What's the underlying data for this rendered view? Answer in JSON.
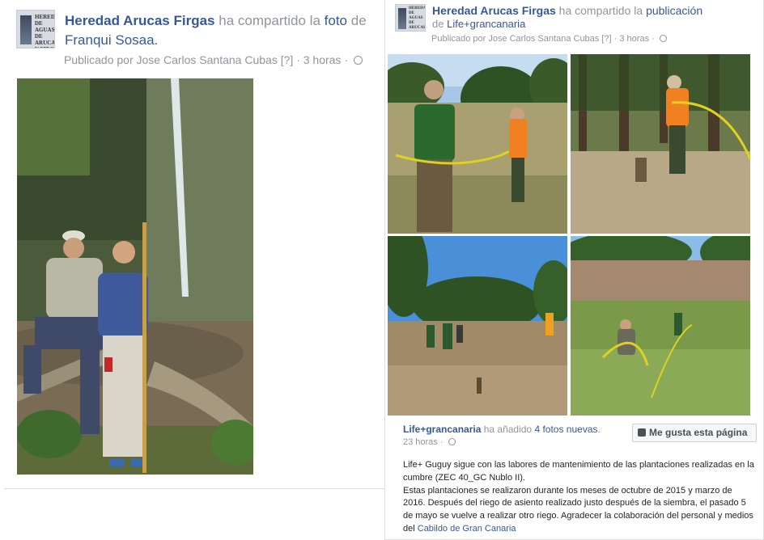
{
  "left_post": {
    "page_name": "Heredad Arucas Firgas",
    "action_text": "ha compartido la",
    "action_link": "foto",
    "action_suffix": "de",
    "shared_from": "Franqui Sosaa.",
    "published_by": "Publicado por Jose Carlos Santana Cubas",
    "help_marker": "[?]",
    "time": "· 3 horas ·",
    "privacy_icon": "globe-icon"
  },
  "right_post": {
    "page_name": "Heredad Arucas Firgas",
    "action_text": "ha compartido la",
    "action_link": "publicación",
    "from_prefix": "de",
    "from_page": "Life+grancanaria",
    "published_by": "Publicado por Jose Carlos Santana Cubas",
    "help_marker": "[?]",
    "time": "· 3 horas ·",
    "shared": {
      "author": "Life+grancanaria",
      "action_text": "ha añadido",
      "photos_link": "4 fotos nuevas",
      "photos_suffix": ".",
      "time": "23 horas ·",
      "like_button": "Me gusta esta página",
      "description_1": "Life+ Guguy sigue con las labores de mantenimiento de las plantaciones realizadas en la cumbre (ZEC 40_GC Nublo II).",
      "description_2": "Estas plantaciones se realizaron durante los meses de octubre de 2015 y marzo de 2016. Después del riego de asiento realizado justo después de la siembra, el pasado 5 de mayo se vuelve a realizar otro riego. Agradecer la colaboración del personal y medios del",
      "description_link": "Cabildo de Gran Canaria"
    }
  },
  "avatar_text": "HEREDAD DE AGUAS DE ARUCAS Y FIRGAS",
  "colors": {
    "link": "#365899",
    "meta": "#90949c",
    "text": "#1d2129"
  }
}
